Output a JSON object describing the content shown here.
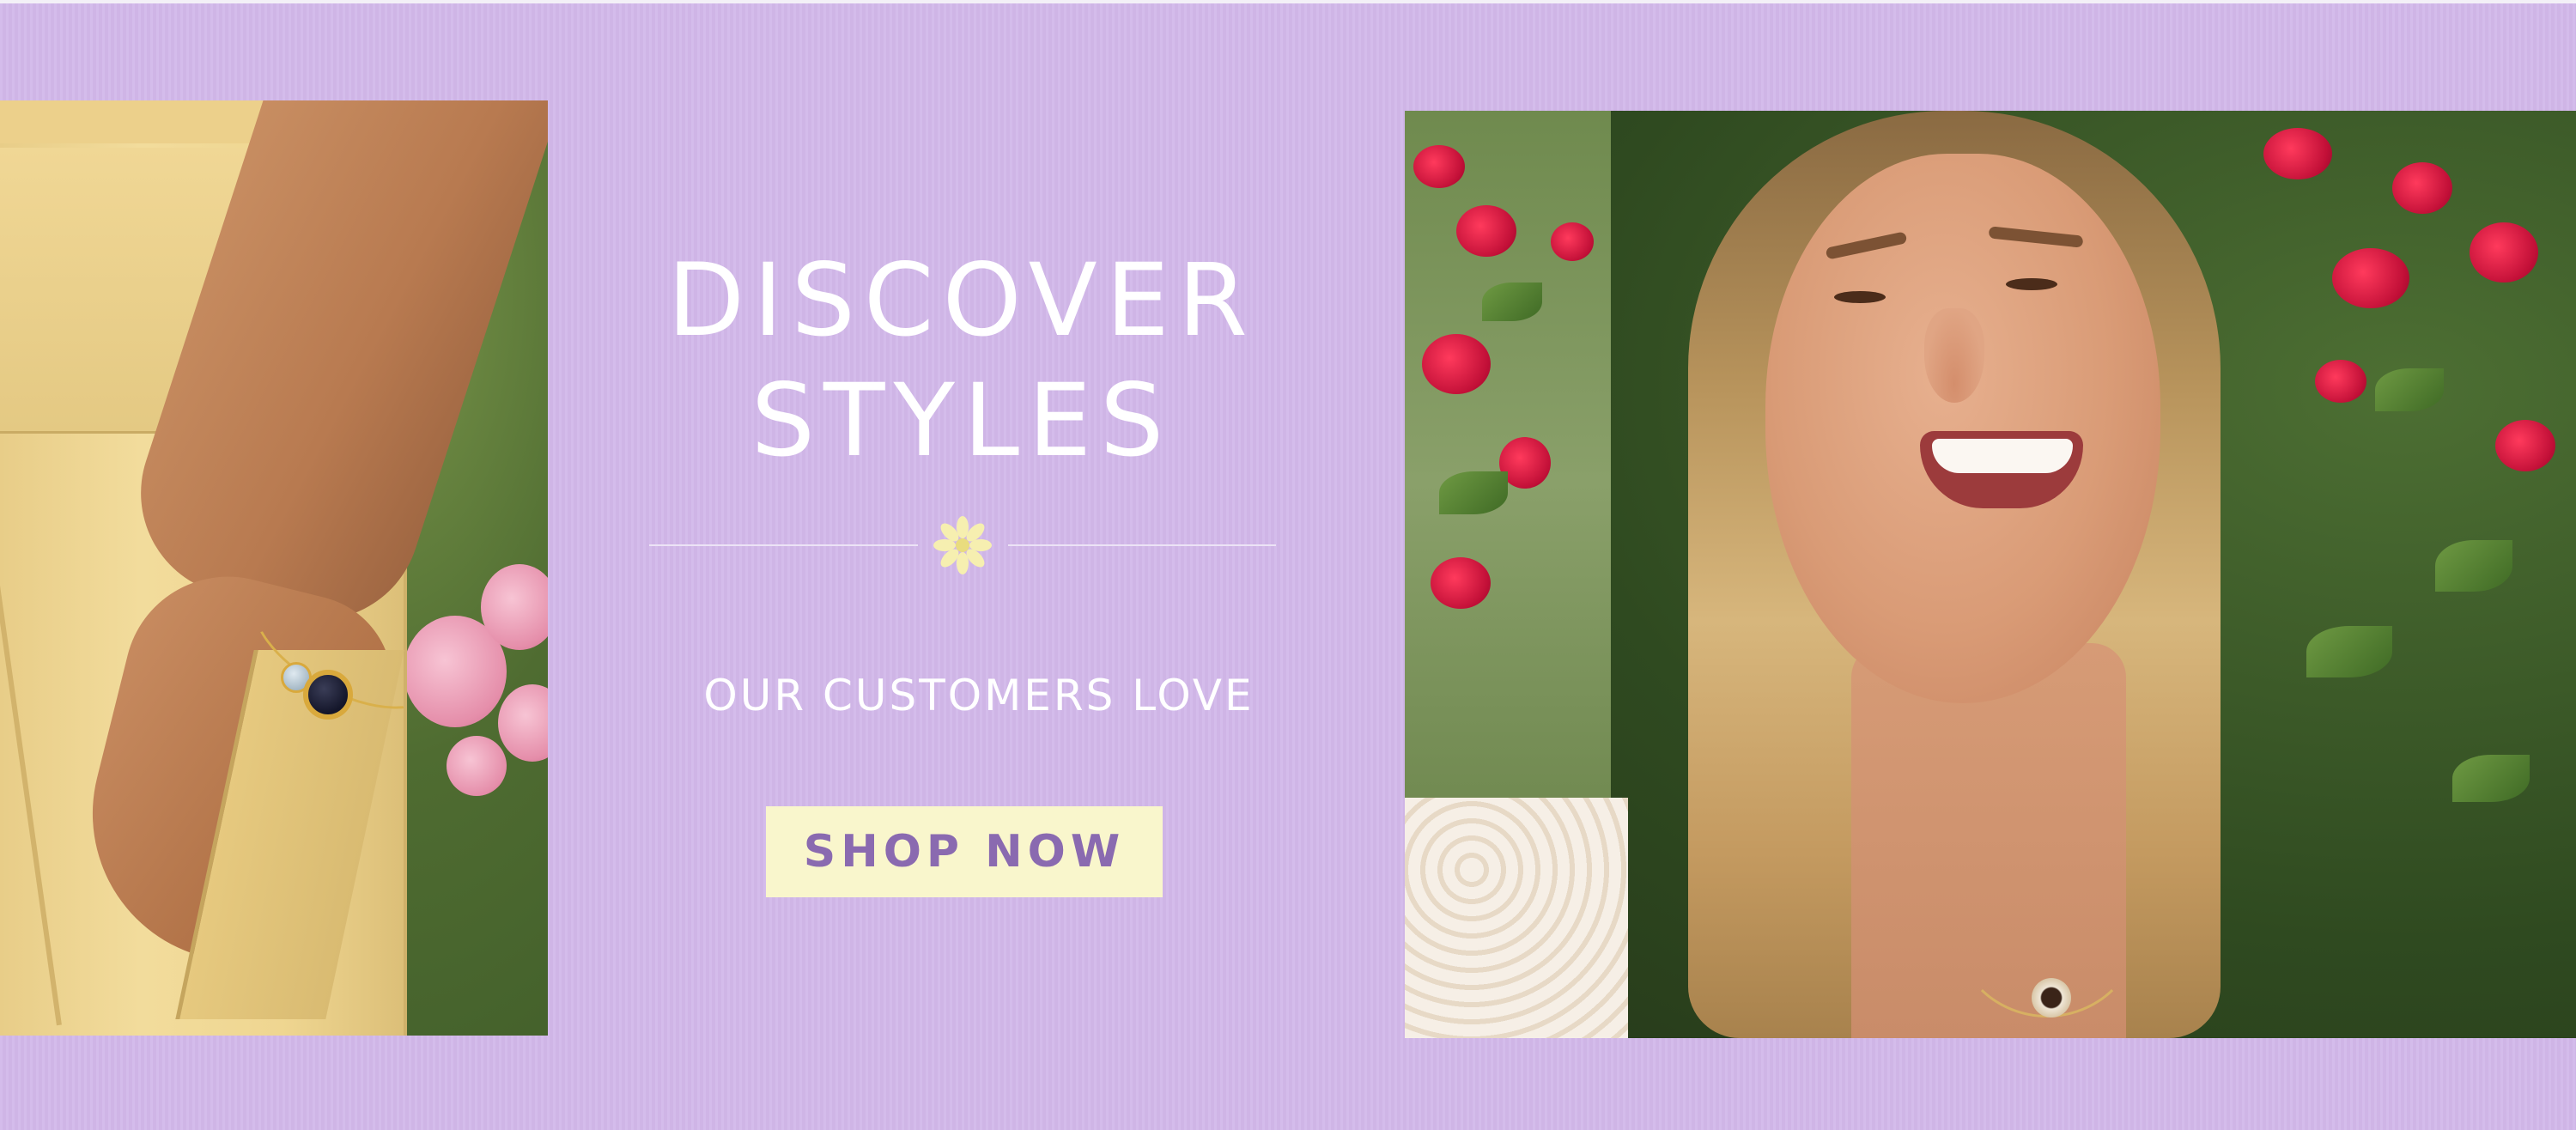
{
  "headline": {
    "line1": "DISCOVER",
    "line2": "STYLES"
  },
  "divider": {
    "icon": "daisy-icon"
  },
  "subheadline": "OUR CUSTOMERS LOVE",
  "cta": {
    "label": "SHOP NOW"
  },
  "images": {
    "left_photo": "hand-in-pocket-bracelet-photo",
    "right_photo": "smiling-woman-necklace-photo"
  },
  "colors": {
    "background": "#d2b8ea",
    "cta_background": "#f9f6cc",
    "cta_text": "#8a6ab0",
    "headline_text": "#ffffff",
    "daisy": "#f6efb0"
  }
}
